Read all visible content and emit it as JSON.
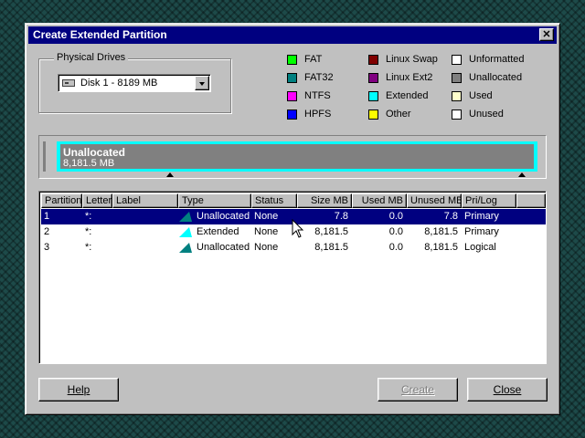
{
  "window": {
    "title": "Create Extended Partition"
  },
  "drives": {
    "group_label": "Physical Drives",
    "selected": "Disk 1 - 8189  MB"
  },
  "legend": [
    {
      "label": "FAT",
      "color": "#00ff00"
    },
    {
      "label": "FAT32",
      "color": "#008080"
    },
    {
      "label": "NTFS",
      "color": "#ff00ff"
    },
    {
      "label": "HPFS",
      "color": "#0000ff"
    },
    {
      "label": "Linux Swap",
      "color": "#800000"
    },
    {
      "label": "Linux Ext2",
      "color": "#800080"
    },
    {
      "label": "Extended",
      "color": "#00ffff"
    },
    {
      "label": "Other",
      "color": "#ffff00"
    },
    {
      "label": "Unformatted",
      "color": "#ffffff"
    },
    {
      "label": "Unallocated",
      "color": "#808080"
    },
    {
      "label": "Used",
      "color": "#ffffcc"
    },
    {
      "label": "Unused",
      "color": "#ffffff"
    }
  ],
  "disk_map": {
    "name": "Unallocated",
    "size": "8,181.5 MB"
  },
  "columns": [
    "Partition",
    "Letter",
    "Label",
    "Type",
    "Status",
    "Size MB",
    "Used MB",
    "Unused MB",
    "Pri/Log"
  ],
  "rows": [
    {
      "partition": "1",
      "letter": "*:",
      "label": "",
      "type": "Unallocated",
      "type_icon": "unallocated-partition-icon",
      "status": "None",
      "size": "7.8",
      "used": "0.0",
      "unused": "7.8",
      "prilog": "Primary"
    },
    {
      "partition": "2",
      "letter": "*:",
      "label": "",
      "type": "Extended",
      "type_icon": "extended-partition-icon",
      "status": "None",
      "size": "8,181.5",
      "used": "0.0",
      "unused": "8,181.5",
      "prilog": "Primary"
    },
    {
      "partition": "3",
      "letter": "*:",
      "label": "",
      "type": "Unallocated",
      "type_icon": "unallocated-partition-icon",
      "status": "None",
      "size": "8,181.5",
      "used": "0.0",
      "unused": "8,181.5",
      "prilog": "Logical"
    }
  ],
  "buttons": {
    "help": "Help",
    "create": "Create",
    "close": "Close"
  },
  "close_glyph": "✕"
}
